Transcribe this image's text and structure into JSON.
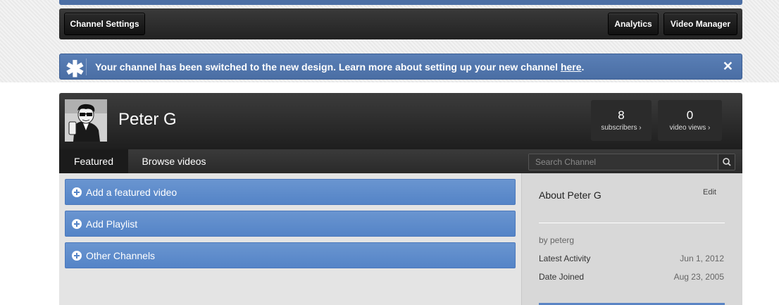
{
  "toolbar": {
    "channel_settings": "Channel Settings",
    "analytics": "Analytics",
    "video_manager": "Video Manager"
  },
  "notice": {
    "icon": "star-asterisk-icon",
    "message": "Your channel has been switched to the new design. Learn more about setting up your new channel ",
    "link": "here",
    "suffix": ".",
    "close": "✕"
  },
  "channel": {
    "name": "Peter G",
    "stats": [
      {
        "value": "8",
        "label": "subscribers ›"
      },
      {
        "value": "0",
        "label": "video views ›"
      }
    ],
    "tabs": [
      {
        "label": "Featured"
      },
      {
        "label": "Browse videos"
      }
    ],
    "search": {
      "placeholder": "Search Channel"
    }
  },
  "sections": [
    {
      "label": "Add a featured video"
    },
    {
      "label": "Add Playlist"
    },
    {
      "label": "Other Channels"
    }
  ],
  "about": {
    "title": "About Peter G",
    "edit": "Edit",
    "by": "by peterg",
    "latest_label": "Latest Activity",
    "latest_value": "Jun 1, 2012",
    "joined_label": "Date Joined",
    "joined_value": "Aug 23, 2005"
  },
  "colors": {
    "notice_blue": "#4a6ea4",
    "section_blue": "#5484c7",
    "header_dark": "#1e1e1e"
  }
}
